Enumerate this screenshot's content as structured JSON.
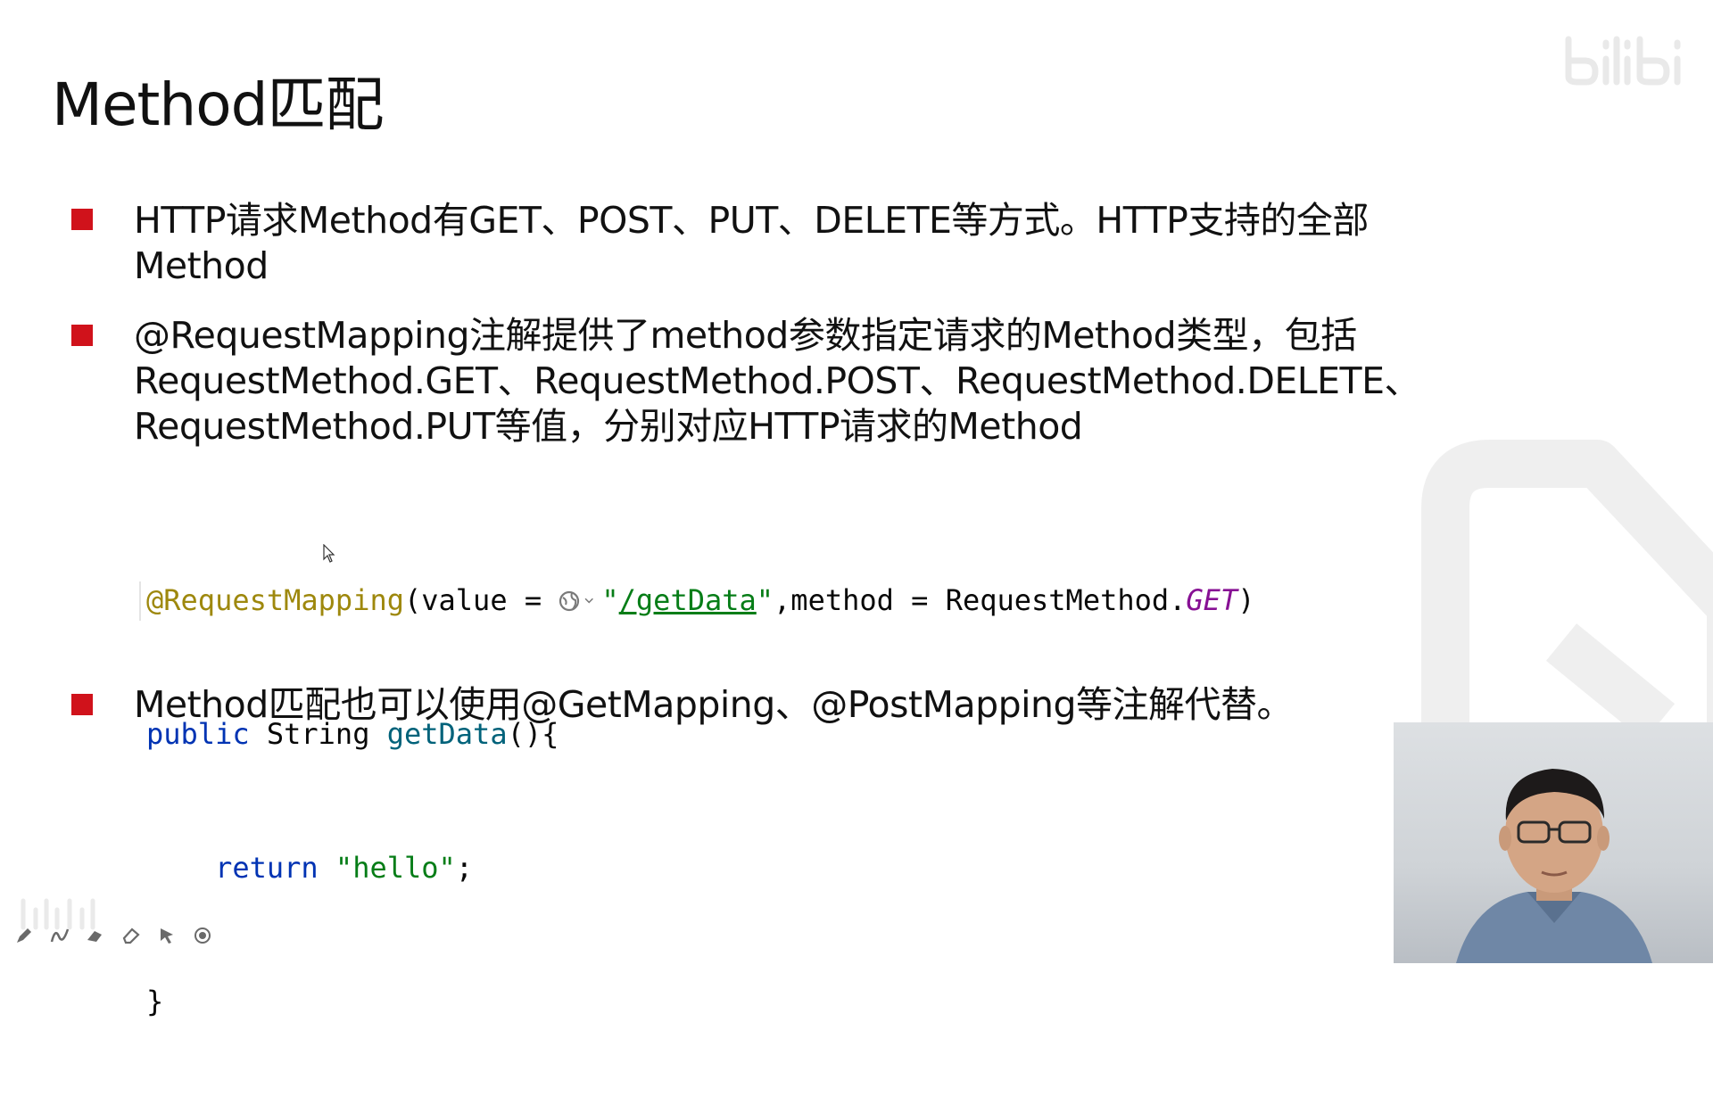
{
  "slide": {
    "title": "Method匹配",
    "bullets": [
      "HTTP请求Method有GET、POST、PUT、DELETE等方式。HTTP支持的全部Method",
      "@RequestMapping注解提供了method参数指定请求的Method类型，包括RequestMethod.GET、RequestMethod.POST、RequestMethod.DELETE、RequestMethod.PUT等值，分别对应HTTP请求的Method",
      "Method匹配也可以使用@GetMapping、@PostMapping等注解代替。"
    ],
    "bullet_lines": [
      [
        "HTTP请求Method有GET、POST、PUT、DELETE等方式。HTTP支持的全部",
        "Method"
      ],
      [
        "@RequestMapping注解提供了method参数指定请求的Method类型，包括",
        "RequestMethod.GET、RequestMethod.POST、RequestMethod.DELETE、",
        "RequestMethod.PUT等值，分别对应HTTP请求的Method"
      ],
      [
        "Method匹配也可以使用@GetMapping、@PostMapping等注解代替。"
      ]
    ],
    "code": {
      "line1": {
        "annotation": "@RequestMapping",
        "open": "(value = ",
        "q1": "\"",
        "url": "/getData",
        "q2": "\"",
        "mid": ",method = RequestMethod.",
        "const": "GET",
        "close": ")"
      },
      "line2": {
        "kw": "public",
        "type": " String ",
        "fn": "getData",
        "rest": "(){"
      },
      "line3": {
        "indent": "    ",
        "kw": "return",
        "sp": " ",
        "str": "\"hello\"",
        "end": ";"
      },
      "line4": "}"
    }
  },
  "colors": {
    "bullet": "#d0121b",
    "annotation": "#9e880d",
    "keyword": "#0033b3",
    "function": "#00627a",
    "string": "#067d17",
    "constant": "#871094"
  },
  "toolbar": {
    "icons": [
      "pen-icon",
      "curve-icon",
      "highlighter-icon",
      "eraser-icon",
      "pointer-icon",
      "record-icon"
    ]
  }
}
